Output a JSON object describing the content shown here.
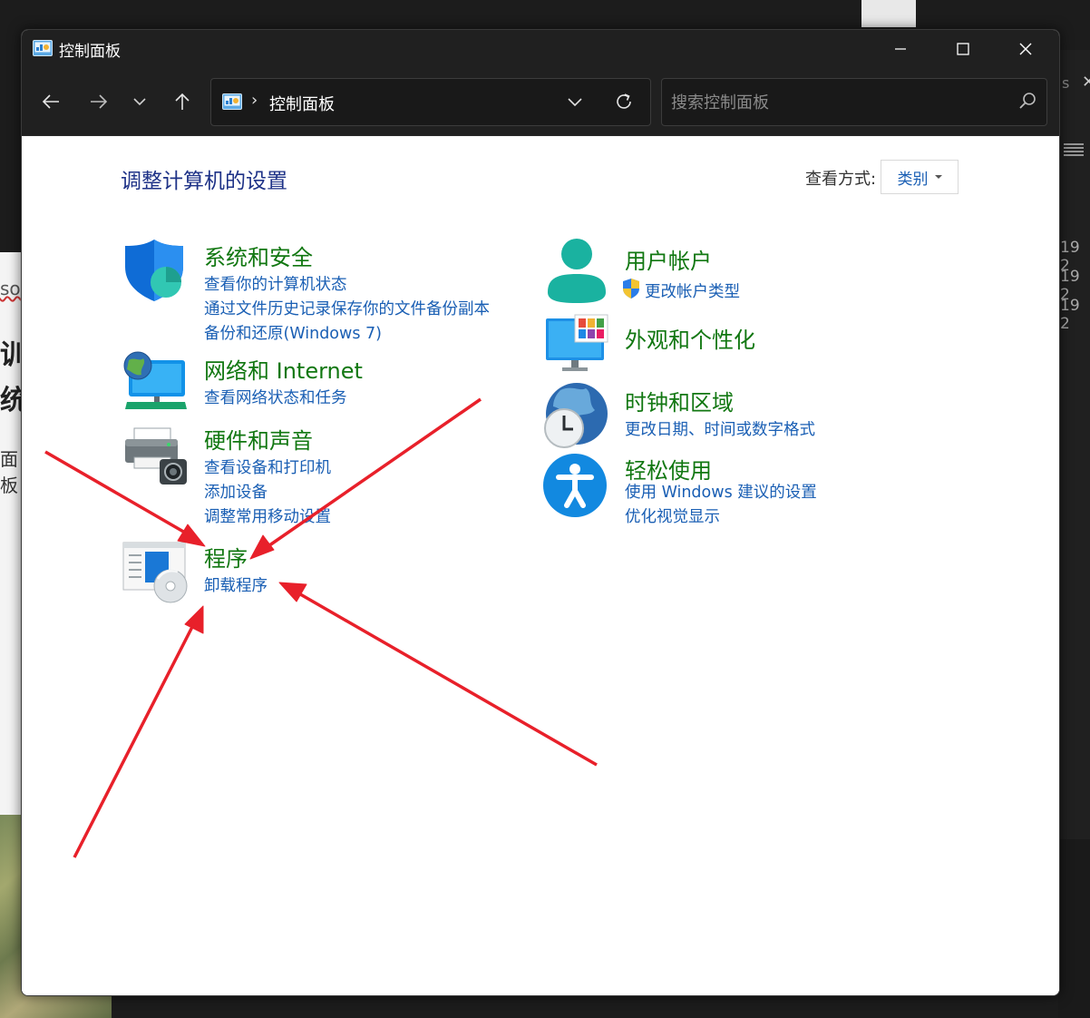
{
  "window": {
    "title": "控制面板",
    "accent_colors": {
      "category_title": "#117711",
      "link": "#1a5fb4",
      "page_title": "#1e3287",
      "annotation": "#e8202a"
    }
  },
  "navigation": {
    "address": {
      "separator": "›",
      "path_item": "控制面板"
    },
    "search": {
      "placeholder": "搜索控制面板"
    }
  },
  "content": {
    "title": "调整计算机的设置",
    "view_by": {
      "label": "查看方式:",
      "value": "类别"
    },
    "categories": [
      {
        "title": "系统和安全",
        "icon": "shield-icon",
        "links": [
          "查看你的计算机状态",
          "通过文件历史记录保存你的文件备份副本",
          "备份和还原(Windows 7)"
        ]
      },
      {
        "title": "网络和 Internet",
        "icon": "network-icon",
        "links": [
          "查看网络状态和任务"
        ]
      },
      {
        "title": "硬件和声音",
        "icon": "printer-icon",
        "links": [
          "查看设备和打印机",
          "添加设备",
          "调整常用移动设置"
        ]
      },
      {
        "title": "程序",
        "icon": "programs-icon",
        "links": [
          "卸载程序"
        ]
      },
      {
        "title": "用户帐户",
        "icon": "user-icon",
        "links": [
          "更改帐户类型"
        ]
      },
      {
        "title": "外观和个性化",
        "icon": "monitor-icon",
        "links": []
      },
      {
        "title": "时钟和区域",
        "icon": "clock-globe-icon",
        "links": [
          "更改日期、时间或数字格式"
        ]
      },
      {
        "title": "轻松使用",
        "icon": "accessibility-icon",
        "links": [
          "使用 Windows 建议的设置",
          "优化视觉显示"
        ]
      }
    ]
  },
  "background": {
    "right_strip_text": [
      "19 2",
      "19 2",
      "19 2"
    ],
    "left_fragments": [
      "so",
      "训",
      "统",
      "面板"
    ]
  }
}
